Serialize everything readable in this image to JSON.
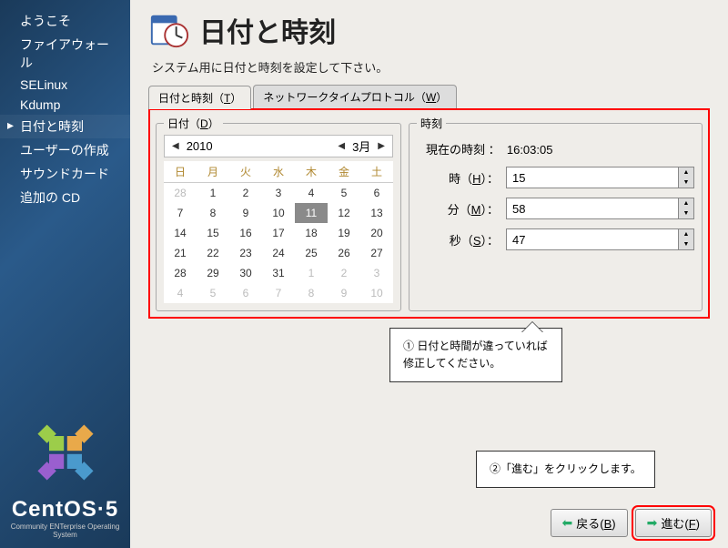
{
  "sidebar": {
    "items": [
      {
        "label": "ようこそ"
      },
      {
        "label": "ファイアウォール"
      },
      {
        "label": "SELinux"
      },
      {
        "label": "Kdump"
      },
      {
        "label": "日付と時刻",
        "active": true
      },
      {
        "label": "ユーザーの作成"
      },
      {
        "label": "サウンドカード"
      },
      {
        "label": "追加の CD"
      }
    ],
    "product": "CentOS",
    "version": "5",
    "tagline": "Community ENTerprise Operating System"
  },
  "page": {
    "title": "日付と時刻",
    "subhead": "システム用に日付と時刻を設定して下さい。"
  },
  "tabs": {
    "date_label": "日付と時刻（",
    "date_accel": "T",
    "date_tail": "）",
    "ntp_label": "ネットワークタイムプロトコル（",
    "ntp_accel": "W",
    "ntp_tail": "）"
  },
  "date": {
    "legend_pre": "日付（",
    "legend_accel": "D",
    "legend_post": "）",
    "year": "2010",
    "month": "3月",
    "dows": [
      "日",
      "月",
      "火",
      "水",
      "木",
      "金",
      "土"
    ],
    "rows": [
      [
        {
          "v": "28",
          "dim": true
        },
        {
          "v": "1"
        },
        {
          "v": "2"
        },
        {
          "v": "3"
        },
        {
          "v": "4"
        },
        {
          "v": "5"
        },
        {
          "v": "6"
        }
      ],
      [
        {
          "v": "7"
        },
        {
          "v": "8"
        },
        {
          "v": "9"
        },
        {
          "v": "10"
        },
        {
          "v": "11",
          "sel": true
        },
        {
          "v": "12"
        },
        {
          "v": "13"
        }
      ],
      [
        {
          "v": "14"
        },
        {
          "v": "15"
        },
        {
          "v": "16"
        },
        {
          "v": "17"
        },
        {
          "v": "18"
        },
        {
          "v": "19"
        },
        {
          "v": "20"
        }
      ],
      [
        {
          "v": "21"
        },
        {
          "v": "22"
        },
        {
          "v": "23"
        },
        {
          "v": "24"
        },
        {
          "v": "25"
        },
        {
          "v": "26"
        },
        {
          "v": "27"
        }
      ],
      [
        {
          "v": "28"
        },
        {
          "v": "29"
        },
        {
          "v": "30"
        },
        {
          "v": "31"
        },
        {
          "v": "1",
          "dim": true
        },
        {
          "v": "2",
          "dim": true
        },
        {
          "v": "3",
          "dim": true
        }
      ],
      [
        {
          "v": "4",
          "dim": true
        },
        {
          "v": "5",
          "dim": true
        },
        {
          "v": "6",
          "dim": true
        },
        {
          "v": "7",
          "dim": true
        },
        {
          "v": "8",
          "dim": true
        },
        {
          "v": "9",
          "dim": true
        },
        {
          "v": "10",
          "dim": true
        }
      ]
    ]
  },
  "time": {
    "legend": "時刻",
    "current_label": "現在の時刻 ：",
    "current_value": "16:03:05",
    "hour_label_pre": "時（",
    "hour_accel": "H",
    "hour_label_post": "）：",
    "hour_value": "15",
    "min_label_pre": "分（",
    "min_accel": "M",
    "min_label_post": "）：",
    "min_value": "58",
    "sec_label_pre": "秒（",
    "sec_accel": "S",
    "sec_label_post": "）：",
    "sec_value": "47"
  },
  "callouts": {
    "c1": "① 日付と時間が違っていれば修正してください。",
    "c2": "②「進む」をクリックします。"
  },
  "buttons": {
    "back_pre": "戻る(",
    "back_accel": "B",
    "back_post": ")",
    "fwd_pre": "進む(",
    "fwd_accel": "F",
    "fwd_post": ")"
  }
}
